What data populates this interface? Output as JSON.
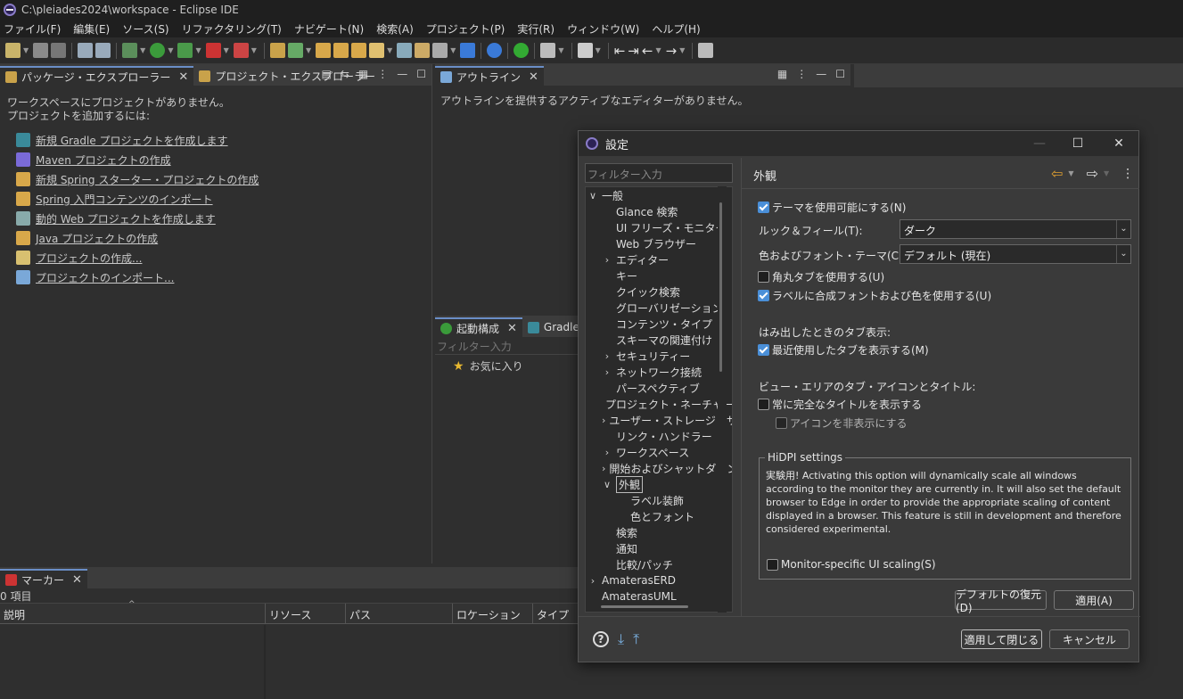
{
  "window": {
    "title": "C:\\pleiades2024\\workspace - Eclipse IDE"
  },
  "menubar": [
    "ファイル(F)",
    "編集(E)",
    "ソース(S)",
    "リファクタリング(T)",
    "ナビゲート(N)",
    "検索(A)",
    "プロジェクト(P)",
    "実行(R)",
    "ウィンドウ(W)",
    "ヘルプ(H)"
  ],
  "package_explorer": {
    "tabs": [
      "パッケージ・エクスプローラー",
      "プロジェクト・エクスプローラー"
    ],
    "message_line1": "ワークスペースにプロジェクトがありません。",
    "message_line2": "プロジェクトを追加するには:",
    "links": [
      "新規 Gradle プロジェクトを作成します",
      "Maven プロジェクトの作成",
      "新規 Spring スターター・プロジェクトの作成",
      "Spring 入門コンテンツのインポート",
      "動的 Web プロジェクトを作成します",
      "Java プロジェクトの作成",
      "プロジェクトの作成...",
      "プロジェクトのインポート..."
    ]
  },
  "outline": {
    "tab": "アウトライン",
    "message": "アウトラインを提供するアクティブなエディターがありません。"
  },
  "launch": {
    "tab": "起動構成",
    "tab2": "Gradle",
    "filter_placeholder": "フィルター入力",
    "favorites": "お気に入り"
  },
  "markers": {
    "tab": "マーカー",
    "count": "0 項目",
    "columns": [
      "説明",
      "リソース",
      "パス",
      "ロケーション",
      "タイプ"
    ]
  },
  "dialog": {
    "title": "設定",
    "filter_placeholder": "フィルター入力",
    "tree": [
      {
        "label": "一般",
        "expander": "open",
        "level": 0
      },
      {
        "label": "Glance 検索",
        "expander": "",
        "level": 1
      },
      {
        "label": "UI フリーズ・モニター",
        "expander": "",
        "level": 1
      },
      {
        "label": "Web ブラウザー",
        "expander": "",
        "level": 1
      },
      {
        "label": "エディター",
        "expander": "closed",
        "level": 1
      },
      {
        "label": "キー",
        "expander": "",
        "level": 1
      },
      {
        "label": "クイック検索",
        "expander": "",
        "level": 1
      },
      {
        "label": "グローバリゼーション",
        "expander": "",
        "level": 1
      },
      {
        "label": "コンテンツ・タイプ",
        "expander": "",
        "level": 1
      },
      {
        "label": "スキーマの関連付け",
        "expander": "",
        "level": 1
      },
      {
        "label": "セキュリティー",
        "expander": "closed",
        "level": 1
      },
      {
        "label": "ネットワーク接続",
        "expander": "closed",
        "level": 1
      },
      {
        "label": "パースペクティブ",
        "expander": "",
        "level": 1
      },
      {
        "label": "プロジェクト・ネーチャー",
        "expander": "",
        "level": 1
      },
      {
        "label": "ユーザー・ストレージ・サー",
        "expander": "closed",
        "level": 1
      },
      {
        "label": "リンク・ハンドラー",
        "expander": "",
        "level": 1
      },
      {
        "label": "ワークスペース",
        "expander": "closed",
        "level": 1
      },
      {
        "label": "開始およびシャットダウン",
        "expander": "closed",
        "level": 1
      },
      {
        "label": "外観",
        "expander": "open",
        "level": 1,
        "selected": true
      },
      {
        "label": "ラベル装飾",
        "expander": "",
        "level": 2
      },
      {
        "label": "色とフォント",
        "expander": "",
        "level": 2
      },
      {
        "label": "検索",
        "expander": "",
        "level": 1
      },
      {
        "label": "通知",
        "expander": "",
        "level": 1
      },
      {
        "label": "比較/パッチ",
        "expander": "",
        "level": 1
      },
      {
        "label": "AmaterasERD",
        "expander": "closed",
        "level": 0
      },
      {
        "label": "AmaterasUML",
        "expander": "",
        "level": 0
      }
    ],
    "page_title": "外観",
    "enable_theme": "テーマを使用可能にする(N)",
    "look_feel_label": "ルック＆フィール(T):",
    "look_feel_value": "ダーク",
    "color_theme_label": "色およびフォント・テーマ(C):",
    "color_theme_value": "デフォルト (現在)",
    "round_tabs": "角丸タブを使用する(U)",
    "mixed_fonts": "ラベルに合成フォントおよび色を使用する(U)",
    "overflow_heading": "はみ出したときのタブ表示:",
    "show_recent": "最近使用したタブを表示する(M)",
    "view_area_heading": "ビュー・エリアのタブ・アイコンとタイトル:",
    "full_title": "常に完全なタイトルを表示する",
    "hide_icons": "アイコンを非表示にする",
    "hidpi_legend": "HiDPI settings",
    "hidpi_text": "実験用! Activating this option will dynamically scale all windows according to the monitor they are currently in. It will also set the default browser to Edge in order to provide the appropriate scaling of content displayed in a browser. This feature is still in development and therefore considered experimental.",
    "monitor_scaling": "Monitor-specific UI scaling(S)",
    "restore_defaults": "デフォルトの復元(D)",
    "apply": "適用(A)",
    "apply_close": "適用して閉じる",
    "cancel": "キャンセル",
    "checks": {
      "enable_theme": true,
      "round_tabs": false,
      "mixed_fonts": true,
      "show_recent": true,
      "full_title": false,
      "hide_icons": false,
      "monitor_scaling": false
    }
  }
}
